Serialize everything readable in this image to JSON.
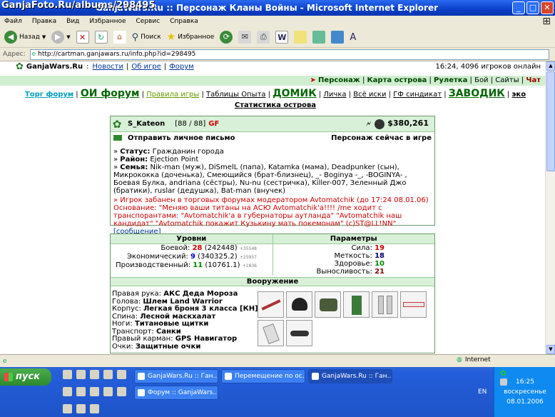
{
  "watermark": "GanjaFoto.Ru/albums/298495",
  "window": {
    "title": "GanjaWars.Ru :: Персонаж Кланы Войны - Microsoft Internet Explorer"
  },
  "menu": [
    "Файл",
    "Правка",
    "Вид",
    "Избранное",
    "Сервис",
    "Справка"
  ],
  "toolbar": {
    "back": "Назад",
    "search": "Поиск",
    "favorites": "Избранное"
  },
  "address": {
    "label": "Адрес:",
    "url": "http://cartman.ganjawars.ru/info.php?id=298495"
  },
  "site": {
    "name": "GanjaWars.Ru",
    "sep": ":",
    "links": [
      "Новости",
      "Об игре",
      "Форум"
    ],
    "online": "16:24, 4096 игроков онлайн"
  },
  "greenbar": {
    "items": [
      "Персонаж",
      "Карта острова",
      "Рулетка",
      "Бой",
      "Сайты"
    ],
    "chat": "Чат"
  },
  "nav": {
    "torg": "Торг форум",
    "oi": "ОИ форум",
    "rules": "Правила игры",
    "tables": "Таблицы Опыта",
    "home": "ДОМИК",
    "personal": "Личка",
    "suits": "Всё иски",
    "gf": "ГФ синдикат",
    "factory": "ЗАВОДИК",
    "eco": "эко Статистика острова"
  },
  "player": {
    "name": "S_Kateon",
    "level": "[88 / 88]",
    "gf": "GF",
    "money": "$380,261",
    "send_msg": "Отправить личное письмо",
    "in_game": "Персонаж сейчас в игре",
    "status_label": "Статус:",
    "status": "Гражданин города",
    "district_label": "Район:",
    "district": "Ejection Point",
    "family_label": "Семья:",
    "family": "Nik-man (муж), DiSmelL (папа), Katamka (мама), Deadpunker (сын), Микрококка (доченька), Смеющийся (брат-близнец), _- Boginya -_, -BOGINYA- , Боевая Булка, andriana (сёстры), Nu-nu (сестричка), Killer-007, Зеленный Джо (братики), ruslar (дедушка), Bat-man (внучек)",
    "ban": "» Игрок забанен в торговых форумах модератором Avtomatchik (до 17:24 08.01.06)",
    "reason": "Основание: \"Меняю ваши титаны на АСЮ Avtomatchik'a!!!! /me ходит с транспорантами: \"Avtomatchik'a в губернаторы аутланда\" \"Avtomatchik наш кандидат\" \"Avtomatchik покажит Кузькину мать покемонам\" (с)ST@LL!NN\"",
    "reason_link": "[сообщение]"
  },
  "levels": {
    "title": "Уровни",
    "rows": [
      {
        "label": "Боевой:",
        "val": "28",
        "exp": "(242448)",
        "add": "+35548"
      },
      {
        "label": "Экономический:",
        "val": "9",
        "exp": "(340325.2)",
        "add": "+25957"
      },
      {
        "label": "Производственный:",
        "val": "11",
        "exp": "(10761.1)",
        "add": "+1836"
      }
    ]
  },
  "params": {
    "title": "Параметры",
    "rows": [
      {
        "label": "Сила:",
        "val": "19"
      },
      {
        "label": "Меткость:",
        "val": "18"
      },
      {
        "label": "Здоровье:",
        "val": "10"
      },
      {
        "label": "Выносливость:",
        "val": "21"
      }
    ]
  },
  "weapons": {
    "title": "Вооружение",
    "rows": [
      {
        "label": "Правая рука:",
        "val": "АКС Деда Мороза"
      },
      {
        "label": "Голова:",
        "val": "Шлем Land Warrior"
      },
      {
        "label": "Корпус:",
        "val": "Легкая броня 3 класса [КН]"
      },
      {
        "label": "Спина:",
        "val": "Лесной маскхалат"
      },
      {
        "label": "Ноги:",
        "val": "Титановые щитки"
      },
      {
        "label": "Транспорт:",
        "val": "Санки"
      },
      {
        "label": "Правый карман:",
        "val": "GPS Навигатор"
      },
      {
        "label": "Очки:",
        "val": "Защитные очки"
      }
    ]
  },
  "status": {
    "zone": "Internet"
  },
  "taskbar": {
    "start": "пуск",
    "tasks": [
      "GanjaWars.Ru :: Ган...",
      "Перемещение по ос...",
      "GanjaWars.Ru :: Ган...",
      "Форум :: GanjaWars...."
    ],
    "lang": "EN",
    "time": "16:25",
    "day": "воскресенье",
    "date": "08.01.2006"
  }
}
